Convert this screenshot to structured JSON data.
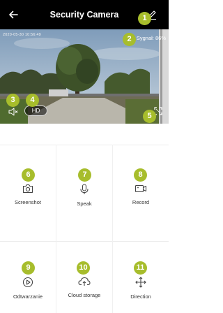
{
  "header": {
    "title": "Security Camera",
    "back_icon": "back-arrow-icon",
    "edit_icon": "pencil-icon"
  },
  "video": {
    "timestamp": "2020-05-30 10:56:49",
    "signal_text": "Sygnał: 86%",
    "quality_label": "HD",
    "mute_icon": "speaker-muted-icon",
    "fullscreen_icon": "fullscreen-icon"
  },
  "badges": [
    "1",
    "2",
    "3",
    "4",
    "5",
    "6",
    "7",
    "8",
    "9",
    "10",
    "11"
  ],
  "badge_color": "#a7bd2c",
  "controls": [
    {
      "label": "Screenshot",
      "icon": "camera-icon"
    },
    {
      "label": "Speak",
      "icon": "microphone-icon"
    },
    {
      "label": "Record",
      "icon": "video-camera-icon"
    },
    {
      "label": "Odtwarzanie",
      "icon": "play-circle-icon"
    },
    {
      "label": "Cloud storage",
      "icon": "cloud-upload-icon"
    },
    {
      "label": "Direction",
      "icon": "move-arrows-icon"
    }
  ]
}
